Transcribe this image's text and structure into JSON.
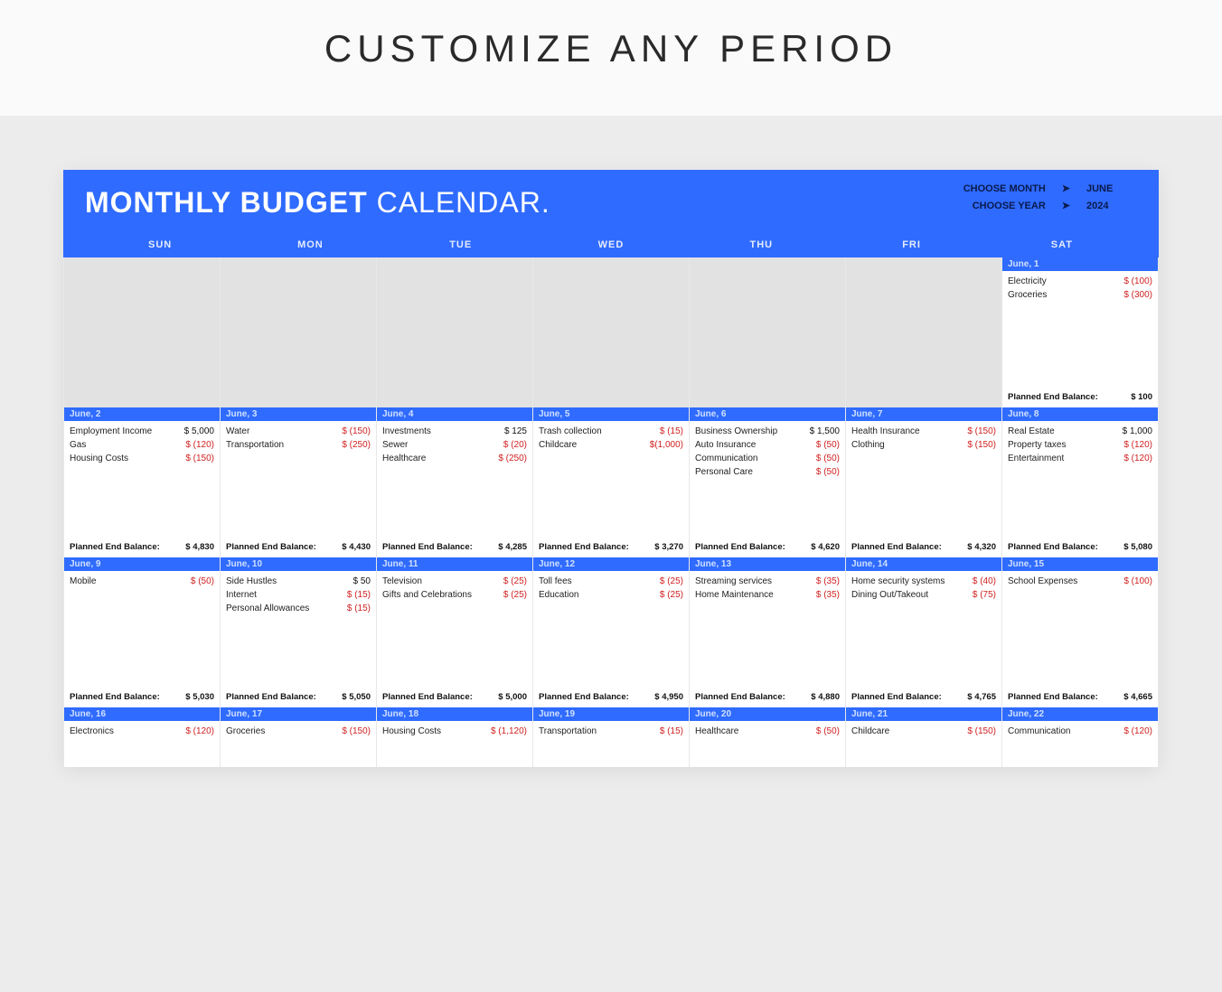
{
  "page_heading": "CUSTOMIZE ANY PERIOD",
  "sheet_title_bold": "MONTHLY BUDGET",
  "sheet_title_light": " CALENDAR.",
  "choose_month_label": "CHOOSE MONTH",
  "choose_year_label": "CHOOSE YEAR",
  "month_value": "JUNE",
  "year_value": "2024",
  "arrow_glyph": "➤",
  "day_names": [
    "SUN",
    "MON",
    "TUE",
    "WED",
    "THU",
    "FRI",
    "SAT"
  ],
  "balance_label": "Planned End Balance:",
  "cells": [
    {
      "empty": true
    },
    {
      "empty": true
    },
    {
      "empty": true
    },
    {
      "empty": true
    },
    {
      "empty": true
    },
    {
      "empty": true
    },
    {
      "date": "June, 1",
      "items": [
        {
          "label": "Electricity",
          "amt": "$   (100)",
          "neg": true
        },
        {
          "label": "Groceries",
          "amt": "$   (300)",
          "neg": true
        }
      ],
      "balance": "$   100"
    },
    {
      "date": "June, 2",
      "items": [
        {
          "label": "Employment Income",
          "amt": "$ 5,000",
          "neg": false
        },
        {
          "label": "Gas",
          "amt": "$   (120)",
          "neg": true
        },
        {
          "label": "Housing Costs",
          "amt": "$   (150)",
          "neg": true
        }
      ],
      "balance": "$ 4,830"
    },
    {
      "date": "June, 3",
      "items": [
        {
          "label": "Water",
          "amt": "$   (150)",
          "neg": true
        },
        {
          "label": "Transportation",
          "amt": "$   (250)",
          "neg": true
        }
      ],
      "balance": "$ 4,430"
    },
    {
      "date": "June, 4",
      "items": [
        {
          "label": "Investments",
          "amt": "$    125",
          "neg": false
        },
        {
          "label": "Sewer",
          "amt": "$    (20)",
          "neg": true
        },
        {
          "label": "Healthcare",
          "amt": "$   (250)",
          "neg": true
        }
      ],
      "balance": "$ 4,285"
    },
    {
      "date": "June, 5",
      "items": [
        {
          "label": "Trash collection",
          "amt": "$    (15)",
          "neg": true
        },
        {
          "label": "Childcare",
          "amt": "$(1,000)",
          "neg": true
        }
      ],
      "balance": "$ 3,270"
    },
    {
      "date": "June, 6",
      "items": [
        {
          "label": "Business Ownership",
          "amt": "$ 1,500",
          "neg": false
        },
        {
          "label": "Auto Insurance",
          "amt": "$    (50)",
          "neg": true
        },
        {
          "label": "Communication",
          "amt": "$    (50)",
          "neg": true
        },
        {
          "label": "Personal Care",
          "amt": "$    (50)",
          "neg": true
        }
      ],
      "balance": "$ 4,620"
    },
    {
      "date": "June, 7",
      "items": [
        {
          "label": "Health Insurance",
          "amt": "$   (150)",
          "neg": true
        },
        {
          "label": "Clothing",
          "amt": "$   (150)",
          "neg": true
        }
      ],
      "balance": "$ 4,320"
    },
    {
      "date": "June, 8",
      "items": [
        {
          "label": "Real Estate",
          "amt": "$ 1,000",
          "neg": false
        },
        {
          "label": "Property taxes",
          "amt": "$   (120)",
          "neg": true
        },
        {
          "label": "Entertainment",
          "amt": "$   (120)",
          "neg": true
        }
      ],
      "balance": "$ 5,080"
    },
    {
      "date": "June, 9",
      "items": [
        {
          "label": "Mobile",
          "amt": "$    (50)",
          "neg": true
        }
      ],
      "balance": "$ 5,030"
    },
    {
      "date": "June, 10",
      "items": [
        {
          "label": "Side Hustles",
          "amt": "$     50",
          "neg": false
        },
        {
          "label": "Internet",
          "amt": "$    (15)",
          "neg": true
        },
        {
          "label": "Personal Allowances",
          "amt": "$    (15)",
          "neg": true
        }
      ],
      "balance": "$ 5,050"
    },
    {
      "date": "June, 11",
      "items": [
        {
          "label": "Television",
          "amt": "$    (25)",
          "neg": true
        },
        {
          "label": "Gifts and Celebrations",
          "amt": "$    (25)",
          "neg": true
        }
      ],
      "balance": "$ 5,000"
    },
    {
      "date": "June, 12",
      "items": [
        {
          "label": "Toll fees",
          "amt": "$    (25)",
          "neg": true
        },
        {
          "label": "Education",
          "amt": "$    (25)",
          "neg": true
        }
      ],
      "balance": "$ 4,950"
    },
    {
      "date": "June, 13",
      "items": [
        {
          "label": "Streaming services",
          "amt": "$    (35)",
          "neg": true
        },
        {
          "label": "Home Maintenance",
          "amt": "$    (35)",
          "neg": true
        }
      ],
      "balance": "$ 4,880"
    },
    {
      "date": "June, 14",
      "items": [
        {
          "label": "Home security systems",
          "amt": "$    (40)",
          "neg": true
        },
        {
          "label": "Dining Out/Takeout",
          "amt": "$    (75)",
          "neg": true
        }
      ],
      "balance": "$ 4,765"
    },
    {
      "date": "June, 15",
      "items": [
        {
          "label": "School Expenses",
          "amt": "$   (100)",
          "neg": true
        }
      ],
      "balance": "$ 4,665"
    },
    {
      "date": "June, 16",
      "short": true,
      "items": [
        {
          "label": "Electronics",
          "amt": "$   (120)",
          "neg": true
        }
      ]
    },
    {
      "date": "June, 17",
      "short": true,
      "items": [
        {
          "label": "Groceries",
          "amt": "$   (150)",
          "neg": true
        }
      ]
    },
    {
      "date": "June, 18",
      "short": true,
      "items": [
        {
          "label": "Housing Costs",
          "amt": "$ (1,120)",
          "neg": true
        }
      ]
    },
    {
      "date": "June, 19",
      "short": true,
      "items": [
        {
          "label": "Transportation",
          "amt": "$    (15)",
          "neg": true
        }
      ]
    },
    {
      "date": "June, 20",
      "short": true,
      "items": [
        {
          "label": "Healthcare",
          "amt": "$    (50)",
          "neg": true
        }
      ]
    },
    {
      "date": "June, 21",
      "short": true,
      "items": [
        {
          "label": "Childcare",
          "amt": "$   (150)",
          "neg": true
        }
      ]
    },
    {
      "date": "June, 22",
      "short": true,
      "items": [
        {
          "label": "Communication",
          "amt": "$   (120)",
          "neg": true
        }
      ]
    }
  ]
}
